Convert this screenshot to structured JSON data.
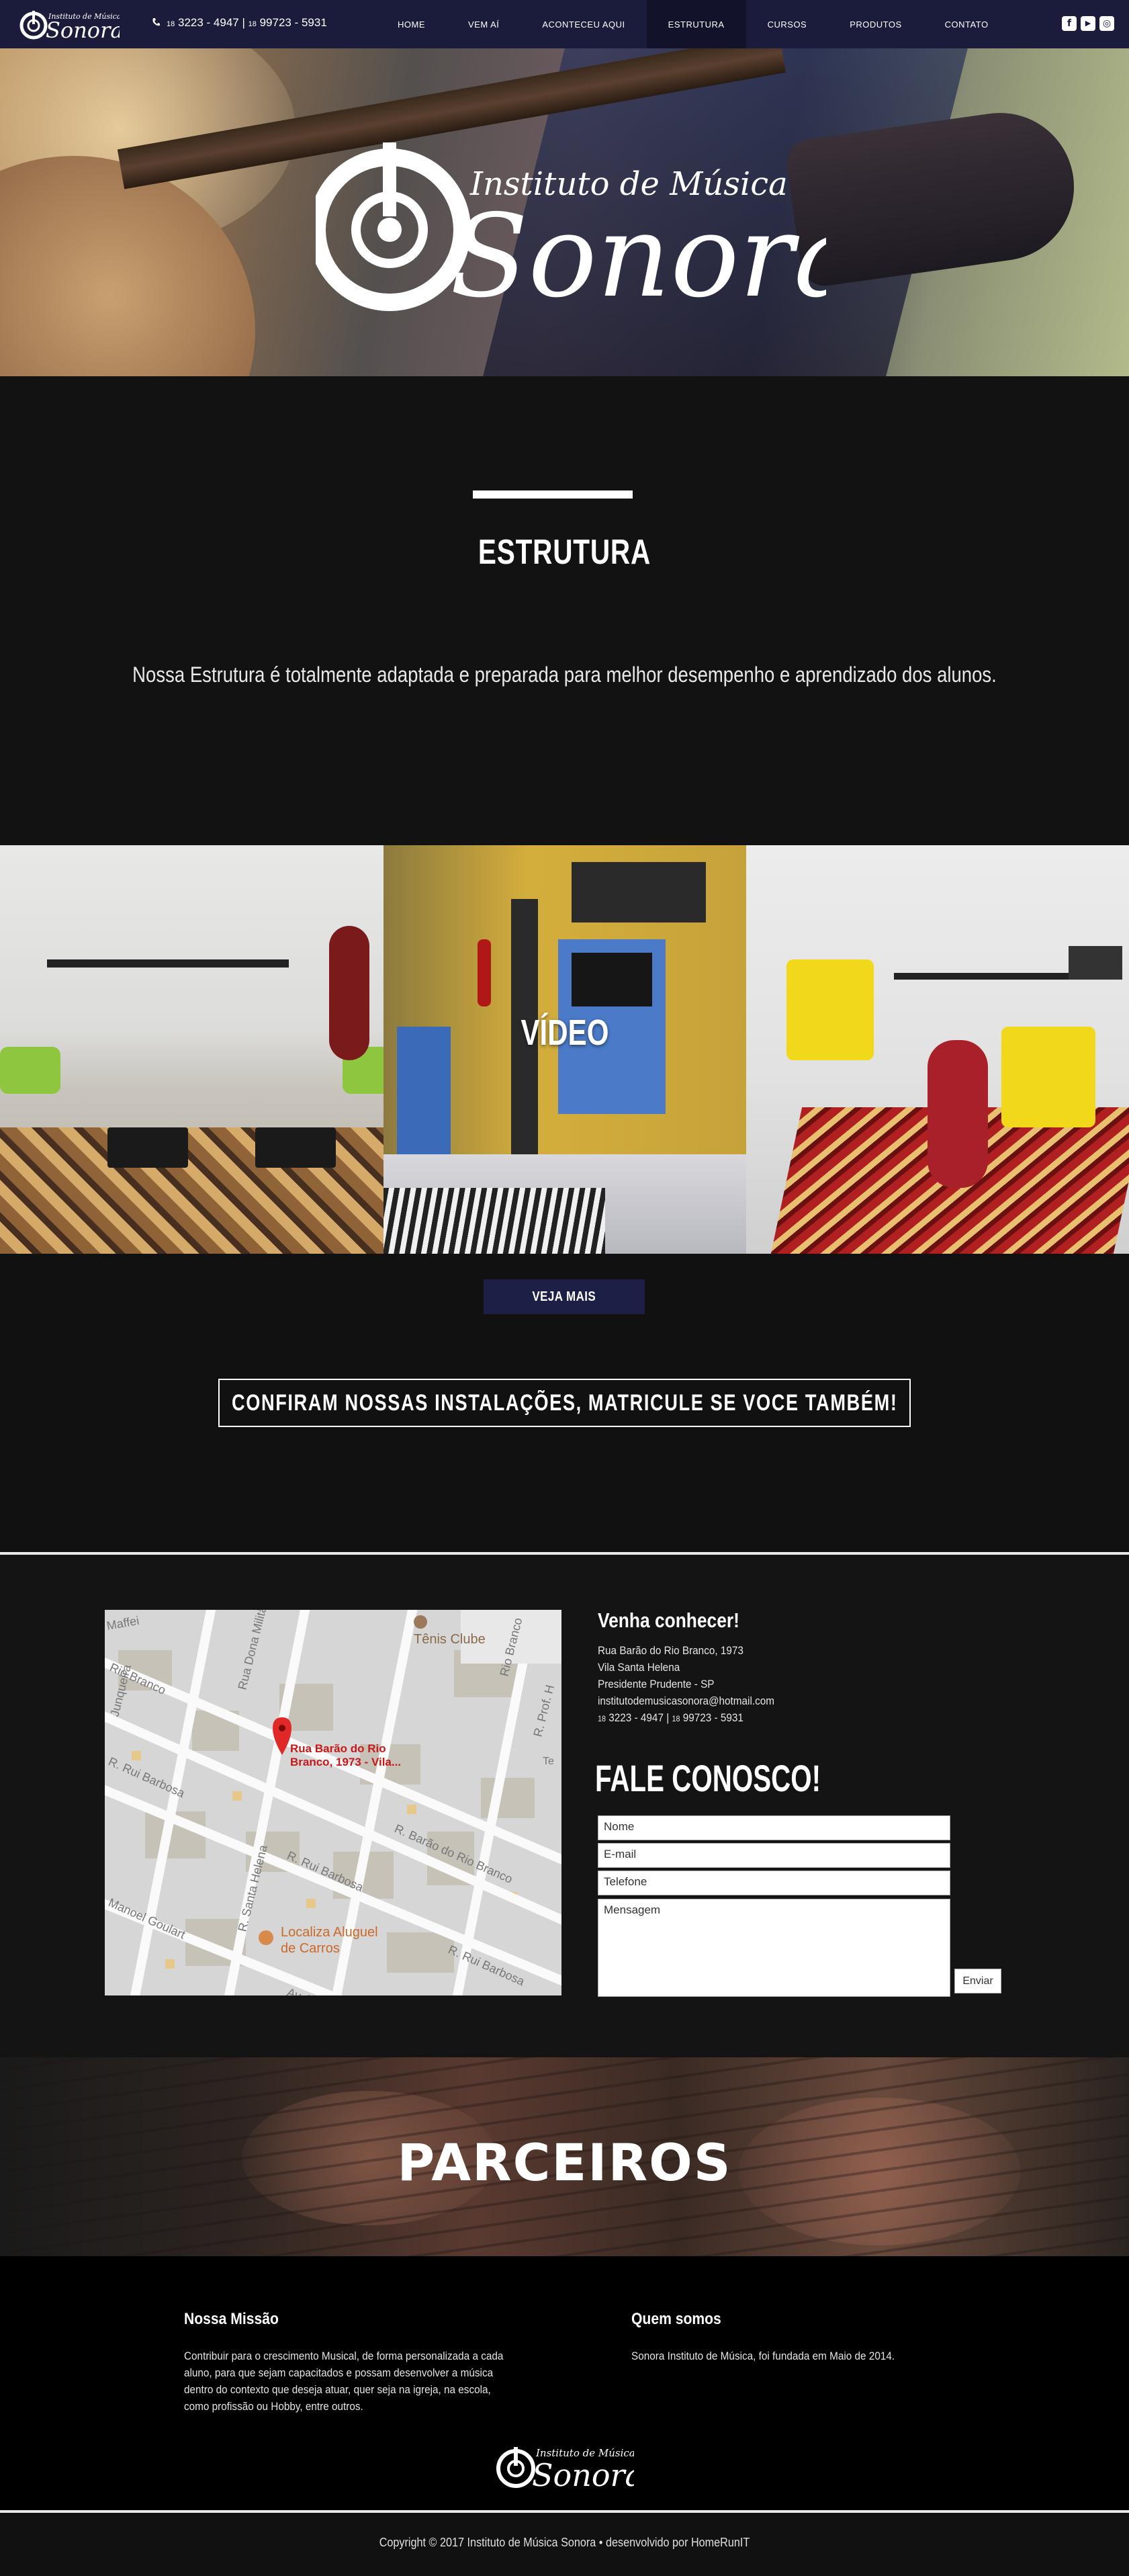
{
  "nav": {
    "phone_ddd1": "18",
    "phone1": "3223 - 4947 |",
    "phone_ddd2": "18",
    "phone2": "99723 - 5931",
    "menu": [
      {
        "label": "HOME"
      },
      {
        "label": "VEM AÍ"
      },
      {
        "label": "ACONTECEU AQUI"
      },
      {
        "label": "ESTRUTURA",
        "active": true
      },
      {
        "label": "CURSOS"
      },
      {
        "label": "PRODUTOS"
      },
      {
        "label": "CONTATO"
      }
    ],
    "social_icons": [
      "facebook-icon",
      "youtube-icon",
      "instagram-icon"
    ]
  },
  "brand": {
    "tagline": "Instituto de Música",
    "name": "Sonora"
  },
  "estrutura": {
    "title": "ESTRUTURA",
    "description": "Nossa Estrutura é totalmente adaptada e preparada para melhor desempenho e aprendizado dos alunos."
  },
  "gallery": {
    "video_label": "VÍDEO"
  },
  "veja_mais": "VEJA MAIS",
  "banner": "CONFIRAM NOSSAS INSTALAÇÕES, MATRICULE SE VOCE TAMBÉM!",
  "contact": {
    "heading": "Venha conhecer!",
    "address_line1": "Rua Barão do Rio Branco, 1973",
    "address_line2": "Vila Santa Helena",
    "address_line3": "Presidente Prudente - SP",
    "email": "institutodemusicasonora@hotmail.com",
    "phone_ddd1": "18",
    "phone1": "3223 - 4947 |",
    "phone_ddd2": "18",
    "phone2": "99723 - 5931",
    "form_title": "FALE CONOSCO!",
    "fields": {
      "name": "Nome",
      "email": "E-mail",
      "phone": "Telefone",
      "message": "Mensagem"
    },
    "submit": "Enviar",
    "map": {
      "pin_label_1": "Rua Barão do Rio",
      "pin_label_2": "Branco, 1973 - Vila...",
      "streets": [
        "Maffei",
        "Tênis Clube",
        "Rio Branco",
        "R. Rui Barbosa",
        "R. Barão do Rio Branco",
        "Rua Dona Militã",
        "R. Prof. H",
        "R. Rui Barbosa",
        "R. Santa Helena",
        "Manoel Goulart",
        "R. Rui Barbosa",
        "Localiza Aluguel",
        "de Carros",
        "Av. Ma",
        "Junqueira",
        "Rio Branco",
        "Te"
      ]
    }
  },
  "parceiros": "PARCEIROS",
  "footer": {
    "mission_title": "Nossa Missão",
    "mission_text": "Contribuir para o crescimento Musical, de forma personalizada a cada aluno, para que sejam capacitados e possam desenvolver a música dentro do contexto que deseja atuar, quer seja na igreja, na escola, como profissão ou Hobby, entre outros.",
    "about_title": "Quem somos",
    "about_text": "Sonora Instituto de Música, foi fundada em Maio de 2014.",
    "copyright": "Copyright © 2017 Instituto de Música Sonora  •  desenvolvido por HomeRunIT"
  }
}
